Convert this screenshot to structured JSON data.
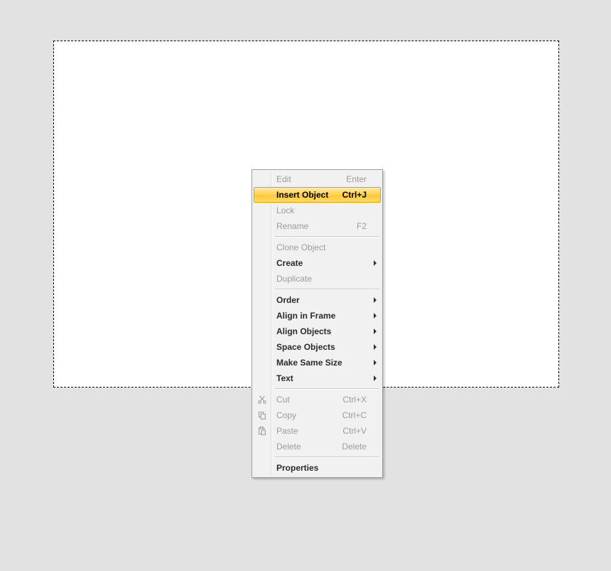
{
  "menu": {
    "items": [
      {
        "id": "edit",
        "label": "Edit",
        "shortcut": "Enter",
        "disabled": true
      },
      {
        "id": "insert-object",
        "label": "Insert Object",
        "shortcut": "Ctrl+J",
        "highlight": true,
        "bold": true
      },
      {
        "id": "lock",
        "label": "Lock",
        "disabled": true
      },
      {
        "id": "rename",
        "label": "Rename",
        "shortcut": "F2",
        "disabled": true
      },
      {
        "type": "separator"
      },
      {
        "id": "clone-object",
        "label": "Clone Object",
        "disabled": true
      },
      {
        "id": "create",
        "label": "Create",
        "submenu": true,
        "bold": true
      },
      {
        "id": "duplicate",
        "label": "Duplicate",
        "disabled": true
      },
      {
        "type": "separator"
      },
      {
        "id": "order",
        "label": "Order",
        "submenu": true,
        "bold": true
      },
      {
        "id": "align-frame",
        "label": "Align in Frame",
        "submenu": true,
        "bold": true
      },
      {
        "id": "align-objects",
        "label": "Align Objects",
        "submenu": true,
        "bold": true
      },
      {
        "id": "space-objects",
        "label": "Space Objects",
        "submenu": true,
        "bold": true
      },
      {
        "id": "make-same-size",
        "label": "Make Same Size",
        "submenu": true,
        "bold": true
      },
      {
        "id": "text",
        "label": "Text",
        "submenu": true,
        "bold": true
      },
      {
        "type": "separator"
      },
      {
        "id": "cut",
        "label": "Cut",
        "shortcut": "Ctrl+X",
        "disabled": true,
        "icon": "cut"
      },
      {
        "id": "copy",
        "label": "Copy",
        "shortcut": "Ctrl+C",
        "disabled": true,
        "icon": "copy"
      },
      {
        "id": "paste",
        "label": "Paste",
        "shortcut": "Ctrl+V",
        "disabled": true,
        "icon": "paste"
      },
      {
        "id": "delete",
        "label": "Delete",
        "shortcut": "Delete",
        "disabled": true
      },
      {
        "type": "separator"
      },
      {
        "id": "properties",
        "label": "Properties",
        "bold": true
      }
    ]
  }
}
